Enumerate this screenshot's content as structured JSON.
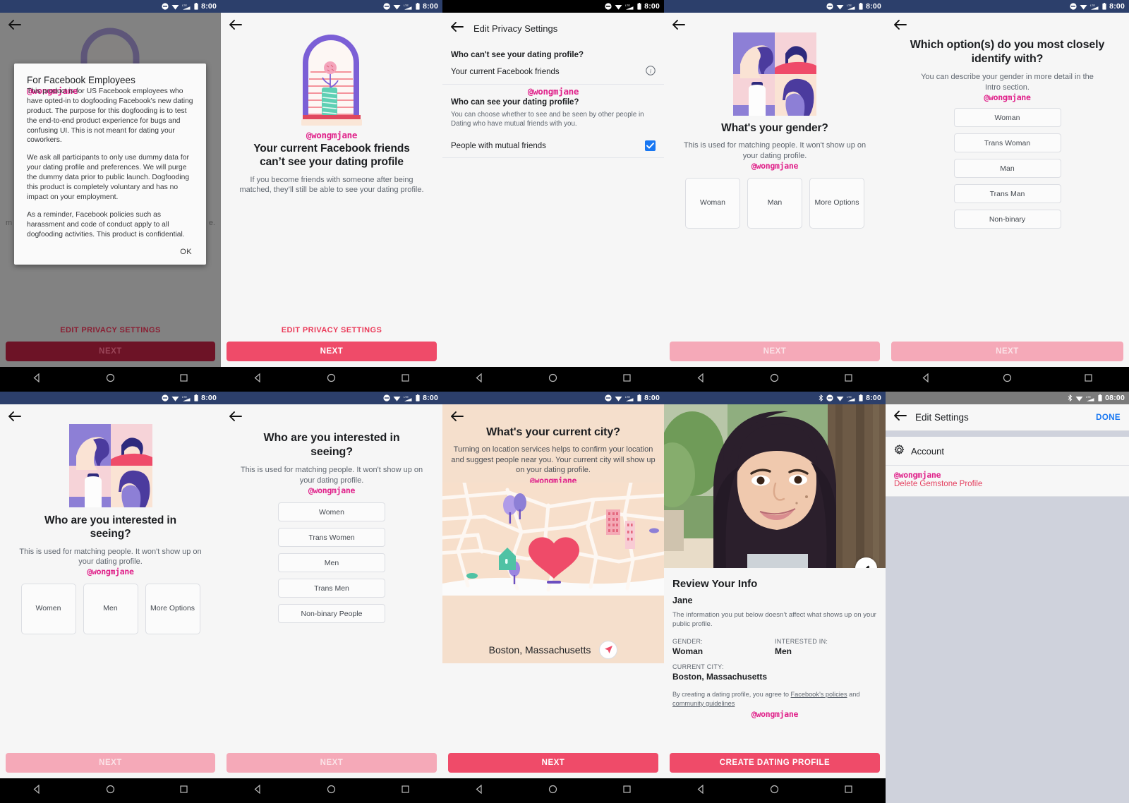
{
  "watermark": "@wongmjane",
  "colors": {
    "accent_pink": "#ef4b69",
    "handle_pink": "#e0218a",
    "status_navy": "#2c3f6b",
    "link_blue": "#1877f2"
  },
  "status_bar": {
    "time": "8:00",
    "time_alt": "08:00",
    "icons": [
      "dnd-icon",
      "wifi-icon",
      "lte-signal-icon",
      "battery-icon"
    ]
  },
  "nav_bar": {
    "back": "back-triangle-icon",
    "home": "home-circle-icon",
    "recents": "recents-square-icon"
  },
  "panels": [
    {
      "id": "employee-notice",
      "background_screen": {
        "edit_privacy_label": "EDIT PRIVACY SETTINGS",
        "next_label": "NEXT"
      },
      "modal": {
        "title": "For Facebook Employees",
        "paragraphs": [
          "This product is for US Facebook employees who have opted-in to dogfooding Facebook's new dating product. The purpose for this dogfooding is to test the end-to-end product experience for bugs and confusing UI. This is not meant for dating your coworkers.",
          "We ask all participants to only use dummy data for your dating profile and preferences. We will purge the dummy data prior to public launch. Dogfooding this product is completely voluntary and has no impact on your employment.",
          "As a reminder, Facebook policies such as harassment and code of conduct apply to all dogfooding activities. This product is confidential."
        ],
        "ok_label": "OK"
      }
    },
    {
      "id": "friends-cant-see",
      "title": "Your current Facebook friends can’t see your dating profile",
      "subtitle": "If you become friends with someone after being matched, they’ll still be able to see your dating profile.",
      "edit_privacy_label": "EDIT PRIVACY SETTINGS",
      "next_label": "NEXT"
    },
    {
      "id": "edit-privacy-settings",
      "app_bar_title": "Edit Privacy Settings",
      "section_1_heading": "Who can't see your dating profile?",
      "row_1_label": "Your current Facebook friends",
      "section_2_heading": "Who can see your dating profile?",
      "section_2_description": "You can choose whether to see and be seen by other people in Dating who have mutual friends with you.",
      "row_2_label": "People with mutual friends",
      "row_2_checked": true
    },
    {
      "id": "your-gender",
      "title": "What's your gender?",
      "subtitle": "This is used for matching people. It won't show up on your dating profile.",
      "options": [
        "Woman",
        "Man",
        "More Options"
      ],
      "next_label": "NEXT"
    },
    {
      "id": "gender-identify",
      "title": "Which option(s) do you most closely identify with?",
      "subtitle": "You can describe your gender in more detail in the Intro section.",
      "options": [
        "Woman",
        "Trans Woman",
        "Man",
        "Trans Man",
        "Non-binary"
      ],
      "next_label": "NEXT"
    },
    {
      "id": "interested-in-seeing",
      "title": "Who are you interested in seeing?",
      "subtitle": "This is used for matching people. It won't show up on your dating profile.",
      "options": [
        "Women",
        "Men",
        "More Options"
      ],
      "next_label": "NEXT"
    },
    {
      "id": "interested-in-seeing-detail",
      "title": "Who are you interested in seeing?",
      "subtitle": "This is used for matching people. It won't show up on your dating profile.",
      "options": [
        "Women",
        "Trans Women",
        "Men",
        "Trans Men",
        "Non-binary People"
      ],
      "next_label": "NEXT"
    },
    {
      "id": "current-city",
      "title": "What's your current city?",
      "subtitle": "Turning on location services helps to confirm your location and suggest people near you. Your current city will show up on your dating profile.",
      "city_value": "Boston, Massachusetts",
      "locate_icon": "navigation-arrow-icon",
      "next_label": "NEXT"
    },
    {
      "id": "review-your-info",
      "heading": "Review Your Info",
      "name": "Jane",
      "note": "The information you put below doesn’t affect what shows up on your public profile.",
      "fields": [
        {
          "label": "GENDER:",
          "value": "Woman"
        },
        {
          "label": "INTERESTED IN:",
          "value": "Men"
        },
        {
          "label": "CURRENT CITY:",
          "value": "Boston, Massachusetts"
        }
      ],
      "legal_prefix": "By creating a dating profile, you agree to ",
      "legal_link_1": "Facebook’s policies",
      "legal_mid": " and ",
      "legal_link_2": "community guidelines",
      "cta_label": "CREATE DATING PROFILE",
      "edit_photo_icon": "pencil-icon"
    },
    {
      "id": "edit-settings",
      "app_bar_title": "Edit Settings",
      "done_label": "DONE",
      "account_label": "Account",
      "account_icon": "gear-icon",
      "delete_label": "Delete Gemstone Profile"
    }
  ]
}
